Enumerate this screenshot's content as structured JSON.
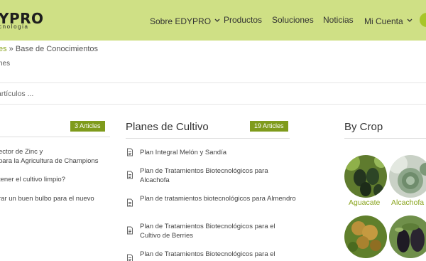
{
  "header": {
    "logo_text": "YPRO",
    "logo_sub": "cnologia",
    "nav": [
      {
        "label": "Sobre EDYPRO",
        "dropdown": true
      },
      {
        "label": "Productos",
        "dropdown": false
      },
      {
        "label": "Soluciones",
        "dropdown": false
      },
      {
        "label": "Noticias",
        "dropdown": false
      },
      {
        "label": "Mi Cuenta",
        "dropdown": true
      }
    ],
    "accent_color": "#cfe085"
  },
  "breadcrumb": {
    "link": "es",
    "separator": " » ",
    "current": "Base de Conocimientos"
  },
  "subcrumb": "nes",
  "search": {
    "placeholder": "artículos ..."
  },
  "left_section": {
    "badge": "3 Articles",
    "items": [
      "ector de Zinc y",
      "para la Agricultura de Champions",
      "tener el cultivo limpio?",
      "rar un buen bulbo para el nuevo"
    ]
  },
  "middle_section": {
    "title": "Planes de Cultivo",
    "badge": "19 Articles",
    "articles": [
      "Plan Integral Melón y Sandía",
      "Plan de Tratamientos Biotecnológicos para Alcachofa",
      "Plan de tratamientos biotecnológicos para Almendro",
      "Plan de Tratamientos Biotecnológicos para el Cultivo de Berries",
      "Plan de Tratamientos Biotecnológicos para el"
    ]
  },
  "right_section": {
    "title": "By Crop",
    "crops": [
      {
        "label": "Aguacate",
        "icon": "avocado-image"
      },
      {
        "label": "Alcachofa",
        "icon": "artichoke-image"
      },
      {
        "label": "",
        "icon": "grain-image"
      },
      {
        "label": "",
        "icon": "eggplant-image"
      }
    ]
  },
  "colors": {
    "badge": "#7f9b1c",
    "link": "#8aa51f"
  }
}
